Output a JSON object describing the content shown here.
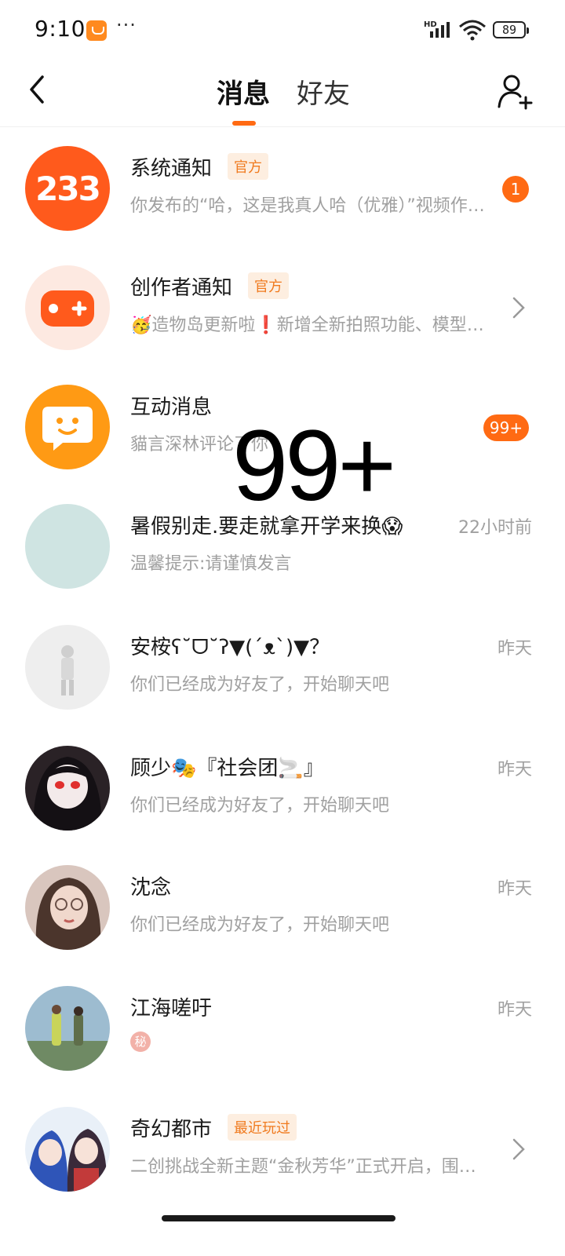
{
  "status_bar": {
    "time": "9:10",
    "more": "···",
    "hd": "HD",
    "battery": "89"
  },
  "header": {
    "tabs": [
      {
        "label": "消息",
        "active": true
      },
      {
        "label": "好友",
        "active": false
      }
    ],
    "accent_color": "#ff6a13"
  },
  "rows": [
    {
      "title": "系统通知",
      "tag": "官方",
      "subtitle": "你发布的“哈，这是我真人哈（优雅）”视频作品已经通过审核",
      "badge": "1",
      "avatar_text": "233"
    },
    {
      "title": "创作者通知",
      "tag": "官方",
      "subtitle": "🥳造物岛更新啦❗新增全新拍照功能、模型素材"
    },
    {
      "title": "互动消息",
      "subtitle": "貓言深林评论了你",
      "badge": "99+"
    },
    {
      "title": "暑假别走.要走就拿开学来换😱",
      "subtitle": "温馨提示:请谨慎发言",
      "time": "22小时前"
    },
    {
      "title": "安桉ʕ˘ᗜ˘ʔ▼(´ᴥ`)▼？",
      "subtitle": "你们已经成为好友了，开始聊天吧",
      "time": "昨天"
    },
    {
      "title": "顾少🎭『社会团🚬』",
      "subtitle": "你们已经成为好友了，开始聊天吧",
      "time": "昨天"
    },
    {
      "title": "沈念",
      "subtitle": "你们已经成为好友了，开始聊天吧",
      "time": "昨天"
    },
    {
      "title": "江海嗟吁",
      "secret": "秘",
      "time": "昨天"
    },
    {
      "title": "奇幻都市",
      "tag": "最近玩过",
      "subtitle": "二创挑战全新主题“金秋芳华”正式开启，围绕秋天创作"
    }
  ],
  "overlay_text": "99+"
}
